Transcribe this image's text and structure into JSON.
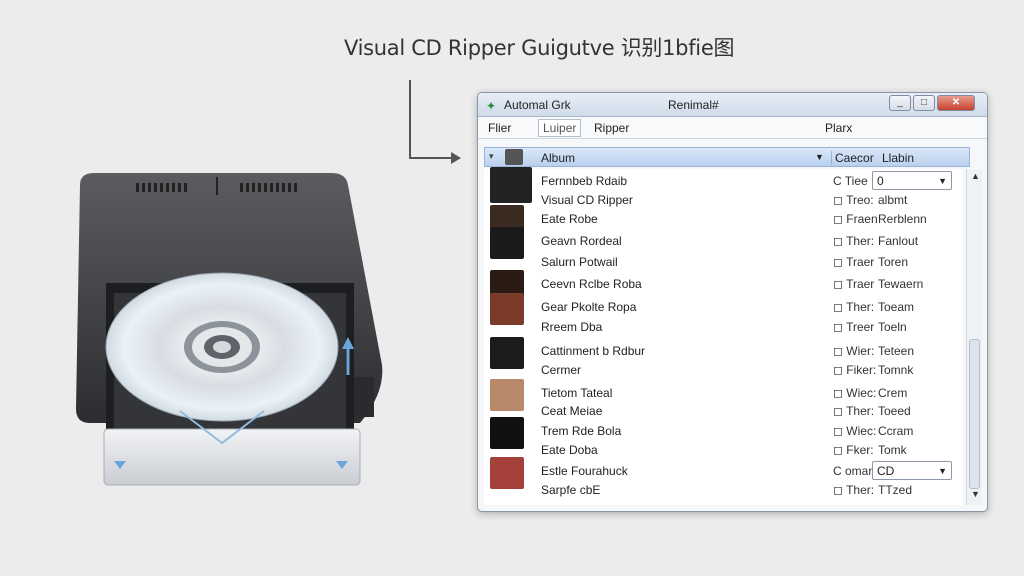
{
  "caption": "Visual CD Ripper Guigutve 识别1bfie图",
  "window": {
    "title_left": "Automal Grk",
    "title_center": "Renimal#",
    "btn_min": "_",
    "btn_max": "□",
    "btn_close": "✕"
  },
  "menu": {
    "file": "Flier",
    "tab": "Luiper",
    "ripper": "Ripper",
    "right": "Plarx"
  },
  "header": {
    "album": "Album",
    "col2": "Caecor",
    "col3": "Llabin"
  },
  "rows": [
    {
      "name": "Fernnbeb Rdaib",
      "flag": "C Tiee",
      "val": "0",
      "select": true
    },
    {
      "name": "Visual CD Ripper",
      "flag": "◻ Treo:",
      "val": "albmt"
    },
    {
      "name": "Eate Robe",
      "flag": "◻ Fraen",
      "val": "Rerblenn"
    },
    {
      "name": "Geavn Rordeal",
      "flag": "◻ Ther:",
      "val": "Fanlout"
    },
    {
      "name": "Salurn Potwail",
      "flag": "◻ Traer",
      "val": "Toren"
    },
    {
      "name": "Ceevn Rclbe Roba",
      "flag": "◻ Traer",
      "val": "Tewaern"
    },
    {
      "name": "Gear Pkolte Ropa",
      "flag": "◻ Ther:",
      "val": "Toeam"
    },
    {
      "name": "Rreem Dba",
      "flag": "◻ Treer",
      "val": "Toeln"
    },
    {
      "name": "Cattinment b Rdbur",
      "flag": "◻ Wier:",
      "val": "Teteen"
    },
    {
      "name": "Cermer",
      "flag": "◻ Fiker:",
      "val": "Tomnk"
    },
    {
      "name": "Tietom Tateal",
      "flag": "◻ Wiec:",
      "val": "Crem"
    },
    {
      "name": "Ceat Meiae",
      "flag": "◻ Ther:",
      "val": "Toeed"
    },
    {
      "name": "Trem Rde Bola",
      "flag": "◻ Wiec:",
      "val": "Ccram"
    },
    {
      "name": "Eate Doba",
      "flag": "◻ Fker:",
      "val": "Tomk"
    },
    {
      "name": "Estle Fourahuck",
      "flag": "C oman",
      "val": "CD",
      "select": true
    },
    {
      "name": "Sarpfe cbE",
      "flag": "◻ Ther:",
      "val": "TTzed"
    }
  ],
  "colors": {
    "accent": "#b9d0ee",
    "close": "#c9412e"
  }
}
